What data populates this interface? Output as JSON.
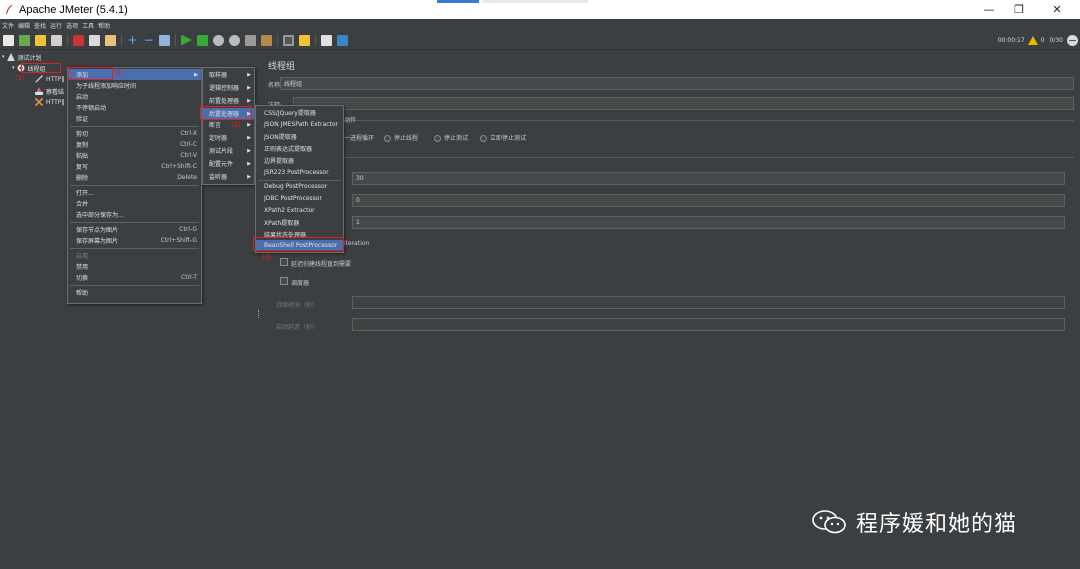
{
  "window": {
    "title": "Apache JMeter (5.4.1)",
    "min_glyph": "—",
    "restore_glyph": "❐",
    "close_glyph": "✕"
  },
  "menubar": [
    "文件",
    "编辑",
    "查找",
    "运行",
    "选项",
    "工具",
    "帮助"
  ],
  "status": {
    "elapsed": "00:00:17",
    "warnings": "0",
    "threads": "0/30"
  },
  "tree": {
    "test_plan": "测试计划",
    "thread_group": "线程组",
    "http1": "HTTP‖",
    "result_tree": "察看结",
    "http2": "HTTP‖"
  },
  "panel": {
    "heading": "线程组",
    "name_label": "名称:",
    "name_value": "线程组",
    "comment_label": "注释:",
    "error_section": "动作",
    "error_options": [
      "一进程循环",
      "停止线程",
      "停止测试",
      "立即停止测试"
    ],
    "threads_value": "30",
    "rampup_value": "0",
    "loop_value": "1",
    "iteration_text": "iteration",
    "delay_label": "延迟创建线程直到需要",
    "scheduler_label": "调度器",
    "duration_label": "持续时间（秒）",
    "startup_delay_label": "启动延迟（秒）"
  },
  "context_menu": {
    "add": "添加",
    "add_think_time": "为子线程添加响应时间",
    "start": "启动",
    "start_no_pause": "不停顿启动",
    "validate": "验证",
    "cut": "剪切",
    "cut_sc": "Ctrl-X",
    "copy": "复制",
    "copy_sc": "Ctrl-C",
    "paste": "粘贴",
    "paste_sc": "Ctrl-V",
    "duplicate": "复写",
    "duplicate_sc": "Ctrl+Shift-C",
    "delete": "删除",
    "delete_sc": "Delete",
    "open": "打开...",
    "merge": "合并",
    "save_selection": "选中部分保存为...",
    "save_node_image": "保存节点为图片",
    "save_node_image_sc": "Ctrl-G",
    "save_screen_image": "保存屏幕为图片",
    "save_screen_image_sc": "Ctrl+Shift-G",
    "enable": "启用",
    "disable": "禁用",
    "toggle": "切换",
    "toggle_sc": "Ctrl-T",
    "help": "帮助"
  },
  "add_submenu": [
    "取样器",
    "逻辑控制器",
    "前置处理器",
    "后置处理器",
    "断言",
    "定时器",
    "测试片段",
    "配置元件",
    "监听器"
  ],
  "post_processors": [
    "CSS/JQuery提取器",
    "JSON JMESPath Extractor",
    "JSON提取器",
    "正则表达式提取器",
    "边界提取器",
    "JSR223 PostProcessor",
    "Debug PostProcessor",
    "JDBC PostProcessor",
    "XPath2 Extractor",
    "XPath提取器",
    "结果状态处理器",
    "BeanShell PostProcessor"
  ],
  "annotations": {
    "a1": "(1)",
    "a2": "(2)",
    "a3": "(3)",
    "a4": "(4)"
  },
  "watermark": "程序媛和她的猫"
}
